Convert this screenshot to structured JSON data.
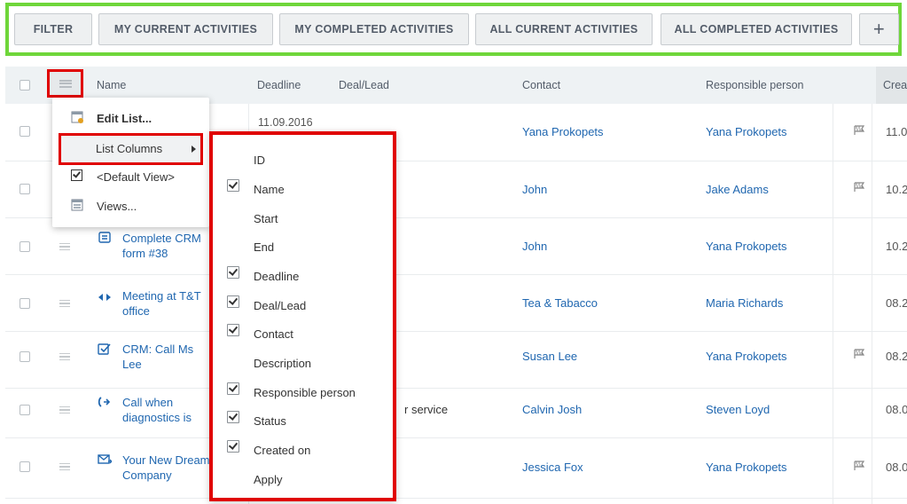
{
  "toolbar": {
    "filter": "FILTER",
    "my_current": "MY CURRENT ACTIVITIES",
    "my_completed": "MY COMPLETED ACTIVITIES",
    "all_current": "ALL CURRENT ACTIVITIES",
    "all_completed": "ALL COMPLETED ACTIVITIES",
    "add": "+"
  },
  "columns": {
    "name": "Name",
    "deadline": "Deadline",
    "deal_lead": "Deal/Lead",
    "contact": "Contact",
    "responsible": "Responsible person",
    "created": "Crea"
  },
  "rows": [
    {
      "name1": "",
      "name2": "",
      "deadline": "11.09.2016",
      "deal": "",
      "contact": "Yana Prokopets",
      "responsible": "Yana Prokopets",
      "flag": true,
      "created": "11.0"
    },
    {
      "name1": "",
      "name2": "",
      "deadline": "",
      "deal": "",
      "contact": "John",
      "responsible": "Jake Adams",
      "flag": true,
      "created": "10.2"
    },
    {
      "name1": "Complete CRM",
      "name2": "form #38",
      "deadline": "",
      "deal": "",
      "contact": "John",
      "responsible": "Yana Prokopets",
      "flag": false,
      "created": "10.2"
    },
    {
      "name1": "Meeting at T&T",
      "name2": "office",
      "deadline": "",
      "deal": "",
      "contact": "Tea & Tabacco",
      "responsible": "Maria Richards",
      "flag": false,
      "created": "08.2"
    },
    {
      "name1": "CRM: Call Ms",
      "name2": "Lee",
      "deadline": "",
      "deal": "",
      "contact": "Susan Lee",
      "responsible": "Yana Prokopets",
      "flag": true,
      "created": "08.2"
    },
    {
      "name1": "Call when",
      "name2": "diagnostics is",
      "deadline": "",
      "deal": "r service",
      "contact": "Calvin Josh",
      "responsible": "Steven Loyd",
      "flag": false,
      "created": "08.0"
    },
    {
      "name1": "Your New Dream",
      "name2": "Company",
      "deadline": "",
      "deal": "",
      "contact": "Jessica Fox",
      "responsible": "Yana Prokopets",
      "flag": true,
      "created": "08.0"
    }
  ],
  "menu": {
    "edit_list": "Edit List...",
    "list_columns": "List Columns",
    "default_view": "<Default View>",
    "views": "Views..."
  },
  "submenu": [
    {
      "label": "ID",
      "checked": false
    },
    {
      "label": "Name",
      "checked": true
    },
    {
      "label": "Start",
      "checked": false
    },
    {
      "label": "End",
      "checked": false
    },
    {
      "label": "Deadline",
      "checked": true
    },
    {
      "label": "Deal/Lead",
      "checked": true
    },
    {
      "label": "Contact",
      "checked": true
    },
    {
      "label": "Description",
      "checked": false
    },
    {
      "label": "Responsible person",
      "checked": true
    },
    {
      "label": "Status",
      "checked": true
    },
    {
      "label": "Created on",
      "checked": true
    },
    {
      "label": "Apply",
      "checked": false
    }
  ],
  "colors": {
    "toolbar_highlight": "#6fd63a",
    "callout_red": "#e00000",
    "link": "#2067b0"
  },
  "icons": {
    "form": "form-icon",
    "meeting": "meeting-icon",
    "task": "task-icon",
    "call": "call-icon",
    "email": "email-icon",
    "flag": "flag-icon"
  }
}
